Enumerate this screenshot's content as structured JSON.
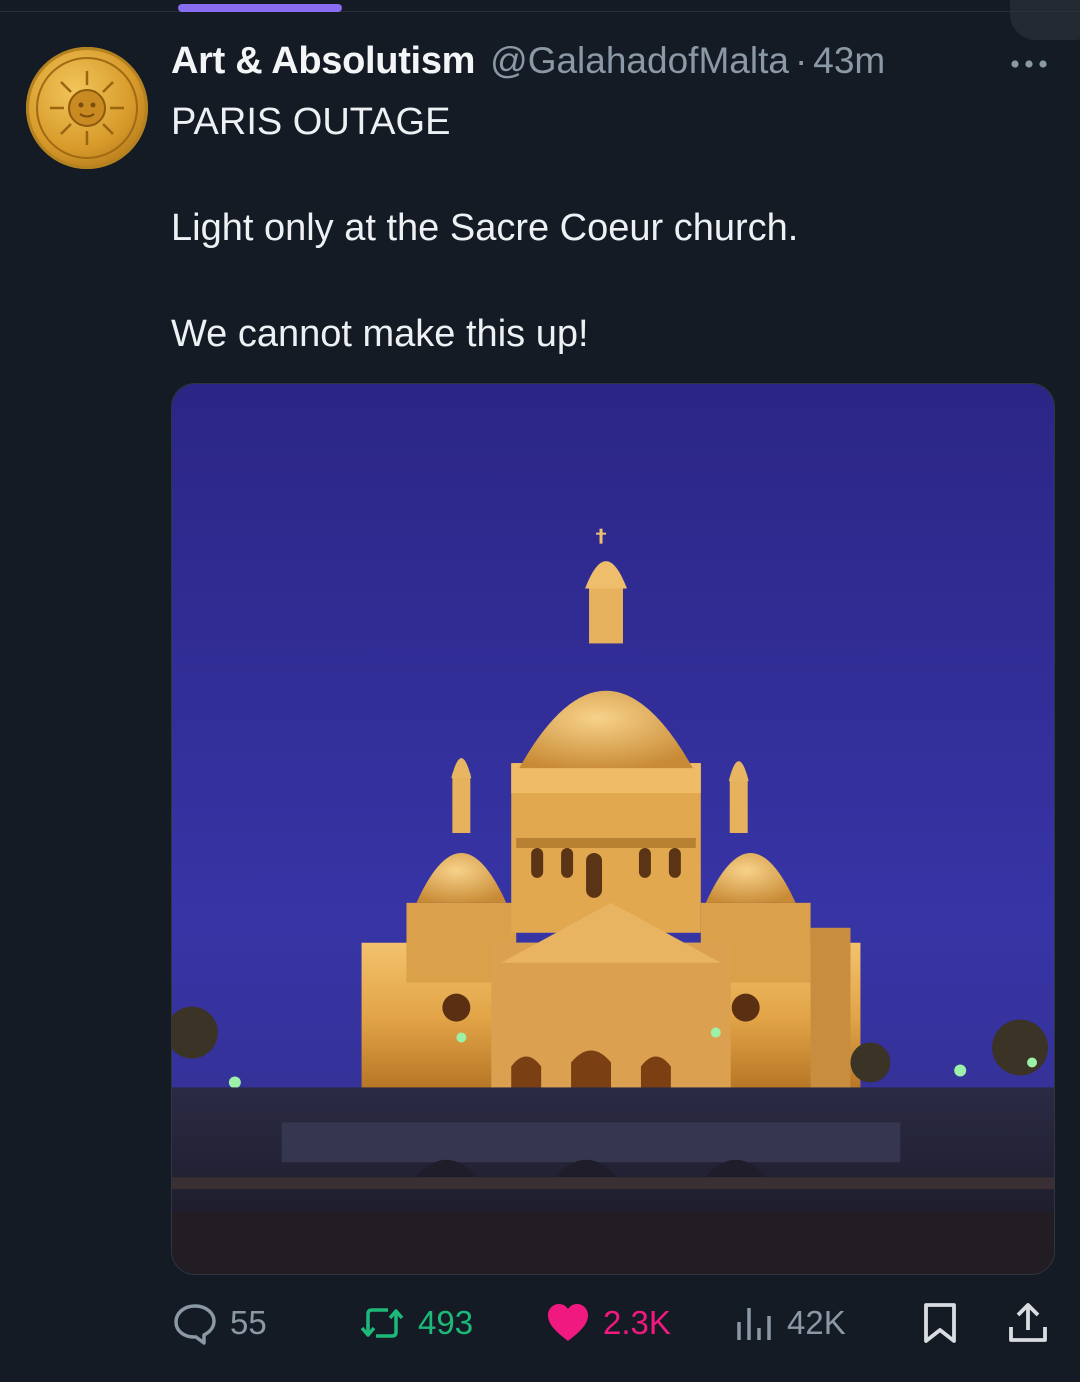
{
  "tweet": {
    "display_name": "Art & Absolutism",
    "handle": "@GalahadofMalta",
    "separator": "·",
    "time": "43m",
    "lines": {
      "line1": "PARIS OUTAGE",
      "line2": "Light only at the Sacre Coeur church.",
      "line3": "We cannot make this up!"
    },
    "avatar_icon": "gold-medallion-avatar",
    "media_icon": "sacre-coeur-night-photo"
  },
  "actions": {
    "replies": "55",
    "retweets": "493",
    "likes": "2.3K",
    "views": "42K"
  },
  "colors": {
    "background": "#151b24",
    "muted": "#8b98a5",
    "retweet": "#1db97a",
    "like": "#f0197f",
    "accent": "#8a6df0"
  }
}
